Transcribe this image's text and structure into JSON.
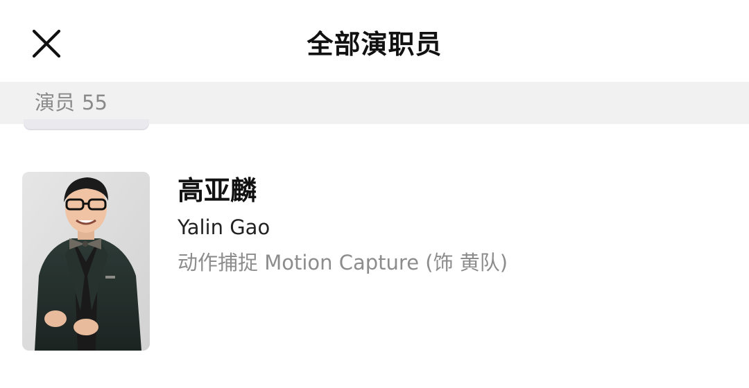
{
  "header": {
    "title": "全部演职员",
    "close_icon": "close-icon"
  },
  "section": {
    "label": "演员",
    "count": "55"
  },
  "cast": [
    {
      "name_cn": "高亚麟",
      "name_en": "Yalin Gao",
      "role": "动作捕捉 Motion Capture (饰 黄队)"
    }
  ],
  "colors": {
    "background": "#ffffff",
    "section_bar": "#f1f1f1",
    "primary_text": "#111111",
    "secondary_text": "#8c8c8c"
  }
}
